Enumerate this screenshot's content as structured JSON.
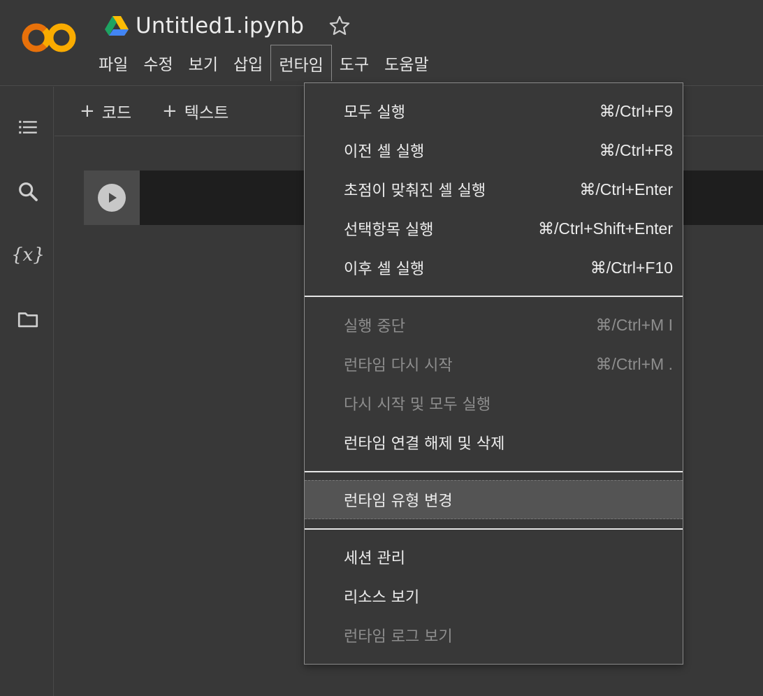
{
  "app": {
    "file_name": "Untitled1.ipynb"
  },
  "colors": {
    "logo_orange_dark": "#e8710a",
    "logo_orange_light": "#f9ab00",
    "background": "#383838"
  },
  "menubar": {
    "items": [
      {
        "label": "파일"
      },
      {
        "label": "수정"
      },
      {
        "label": "보기"
      },
      {
        "label": "삽입"
      },
      {
        "label": "런타임",
        "active": true
      },
      {
        "label": "도구"
      },
      {
        "label": "도움말"
      }
    ]
  },
  "sidebar": {
    "icons": [
      "table-of-contents-icon",
      "search-icon",
      "variables-icon",
      "folder-icon"
    ],
    "variables_glyph": "{x}"
  },
  "toolbar": {
    "code_label": "코드",
    "text_label": "텍스트",
    "plus_glyph": "+"
  },
  "runtime_menu": {
    "items": [
      {
        "label": "모두 실행",
        "shortcut": "⌘/Ctrl+F9",
        "disabled": false
      },
      {
        "label": "이전 셀 실행",
        "shortcut": "⌘/Ctrl+F8",
        "disabled": false
      },
      {
        "label": "초점이 맞춰진 셀 실행",
        "shortcut": "⌘/Ctrl+Enter",
        "disabled": false
      },
      {
        "label": "선택항목 실행",
        "shortcut": "⌘/Ctrl+Shift+Enter",
        "disabled": false
      },
      {
        "label": "이후 셀 실행",
        "shortcut": "⌘/Ctrl+F10",
        "disabled": false
      },
      {
        "label": "실행 중단",
        "shortcut": "⌘/Ctrl+M I",
        "disabled": true
      },
      {
        "label": "런타임 다시 시작",
        "shortcut": "⌘/Ctrl+M .",
        "disabled": true
      },
      {
        "label": "다시 시작 및 모두 실행",
        "shortcut": "",
        "disabled": true
      },
      {
        "label": "런타임 연결 해제 및 삭제",
        "shortcut": "",
        "disabled": false
      },
      {
        "label": "런타임 유형 변경",
        "shortcut": "",
        "disabled": false,
        "highlighted": true
      },
      {
        "label": "세션 관리",
        "shortcut": "",
        "disabled": false
      },
      {
        "label": "리소스 보기",
        "shortcut": "",
        "disabled": false
      },
      {
        "label": "런타임 로그 보기",
        "shortcut": "",
        "disabled": true
      }
    ]
  }
}
